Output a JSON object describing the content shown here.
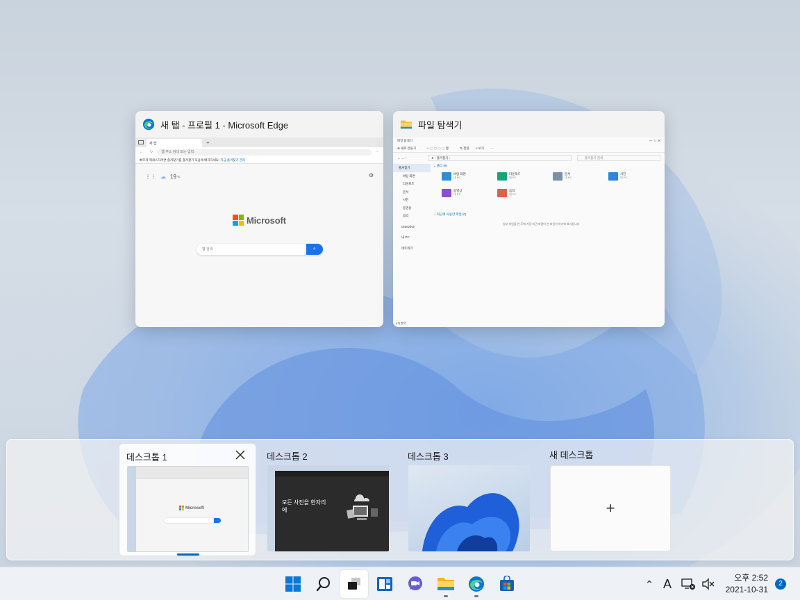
{
  "windows": {
    "edge": {
      "title": "새 탭 - 프로필 1 - Microsoft Edge",
      "tab_label": "새 탭",
      "address_placeholder": "웹 주소 검색 또는 입력",
      "favorites_bar_text": "빠르게 액세스하려면 즐겨찾기를 즐겨찾기 모음에 배치하세요.",
      "favorites_link": "지금 즐겨찾기 관리",
      "weather_temp": "19",
      "weather_unit": "℃",
      "logo_text": "Microsoft",
      "search_placeholder": "웹 검색"
    },
    "explorer": {
      "title": "파일 탐색기",
      "inner_title": "파일 탐색기",
      "new_button": "새로 만들기",
      "sort_label": "정렬",
      "view_label": "보기",
      "address": "즐겨찾기",
      "search_placeholder": "즐겨찾기 검색",
      "nav_items": [
        {
          "label": "즐겨찾기",
          "selected": true
        },
        {
          "label": "바탕 화면",
          "selected": false
        },
        {
          "label": "다운로드",
          "selected": false
        },
        {
          "label": "문서",
          "selected": false
        },
        {
          "label": "사진",
          "selected": false
        },
        {
          "label": "동영상",
          "selected": false
        },
        {
          "label": "음악",
          "selected": false
        },
        {
          "label": "OneDrive",
          "selected": false
        },
        {
          "label": "내 PC",
          "selected": false
        },
        {
          "label": "네트워크",
          "selected": false
        }
      ],
      "section_folders": "폴더 (8)",
      "folders": [
        {
          "name": "바탕 화면",
          "sub": "내 PC",
          "color": "#2a8fd6"
        },
        {
          "name": "다운로드",
          "sub": "내 PC",
          "color": "#1aa37a"
        },
        {
          "name": "문서",
          "sub": "내 PC",
          "color": "#7a8fa8"
        },
        {
          "name": "사진",
          "sub": "내 PC",
          "color": "#2f86d8"
        },
        {
          "name": "동영상",
          "sub": "내 PC",
          "color": "#8b4fd0"
        },
        {
          "name": "음악",
          "sub": "내 PC",
          "color": "#e0604a"
        }
      ],
      "section_recent": "최근에 사용한 파일 (0)",
      "recent_empty": "일부 파일을 연 후에 가장 최근에 열어 본 파일이 여기에 표시됩니다.",
      "status": "6개 항목"
    }
  },
  "desktops": [
    {
      "label": "데스크톱 1",
      "active": true
    },
    {
      "label": "데스크톱 2",
      "active": false,
      "thumb_text": "모든 사진을 한자리에"
    },
    {
      "label": "데스크톱 3",
      "active": false
    },
    {
      "label": "새 데스크톱",
      "plus": "+"
    }
  ],
  "taskbar": {
    "apps": [
      "start",
      "search",
      "task-view",
      "widgets",
      "chat",
      "file-explorer",
      "edge",
      "store"
    ],
    "tray_ime": "A",
    "clock_time": "오후 2:52",
    "clock_date": "2021-10-31",
    "notification_count": "2"
  },
  "colors": {
    "accent": "#0067c0",
    "ms_red": "#f25022",
    "ms_green": "#7fba00",
    "ms_blue": "#00a4ef",
    "ms_yellow": "#ffb900"
  }
}
